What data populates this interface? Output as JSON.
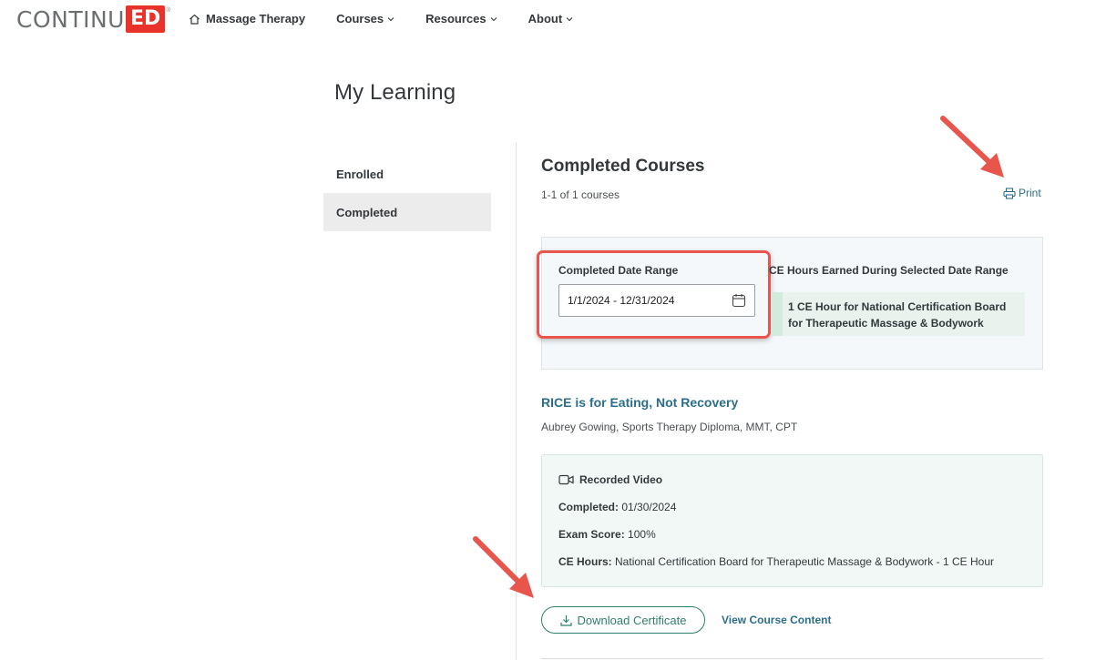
{
  "header": {
    "logo_text": "CONTINU",
    "logo_box_text": "ED",
    "logo_reg": "®",
    "nav": {
      "home_label": "Massage Therapy",
      "courses_label": "Courses",
      "resources_label": "Resources",
      "about_label": "About"
    }
  },
  "page_title": "My Learning",
  "sidebar": {
    "items": [
      {
        "label": "Enrolled"
      },
      {
        "label": "Completed",
        "active": true
      }
    ]
  },
  "main": {
    "section_title": "Completed Courses",
    "count_text": "1-1 of 1 courses",
    "print_label": "Print",
    "filter": {
      "date_range_label": "Completed Date Range",
      "date_range_value": "1/1/2024 - 12/31/2024",
      "earned_label": "CE Hours Earned During Selected Date Range",
      "earned_line1": "1 CE Hour for National Certification Board",
      "earned_line2": "for Therapeutic Massage & Bodywork"
    },
    "course": {
      "title": "RICE is for Eating, Not Recovery",
      "author": "Aubrey Gowing, Sports Therapy Diploma, MMT, CPT",
      "format": "Recorded Video",
      "completed_label": "Completed:",
      "completed_value": "01/30/2024",
      "exam_label": "Exam Score:",
      "exam_value": "100%",
      "ce_label": "CE Hours:",
      "ce_value": "National Certification Board for Therapeutic Massage & Bodywork - 1 CE Hour"
    },
    "download_label": "Download Certificate",
    "view_label": "View Course Content"
  },
  "colors": {
    "brand_red": "#e8322a",
    "link_blue": "#2c6e8a",
    "button_green": "#2f7f6e",
    "annotation_red": "#e8554c"
  }
}
